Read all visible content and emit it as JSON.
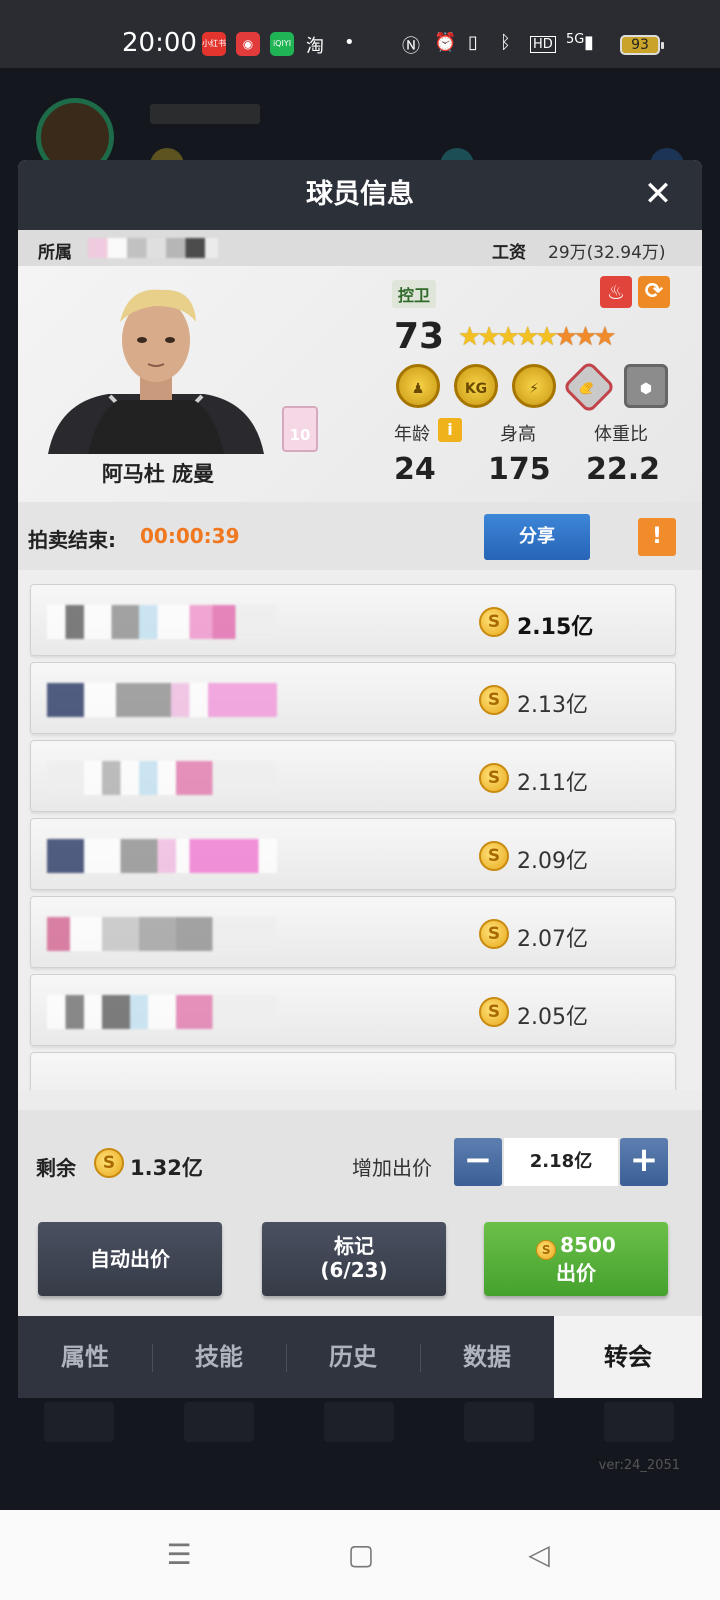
{
  "status_bar": {
    "time": "20:00",
    "apps": [
      "小红书",
      "网易云",
      "iQIYI",
      "淘"
    ],
    "dot": "•",
    "network": "5G",
    "hd": "HD",
    "battery": "93"
  },
  "modal": {
    "title": "球员信息",
    "close_glyph": "✕"
  },
  "info_row": {
    "owner_label": "所属",
    "salary_label": "工资",
    "salary_value": "29万(32.94万)"
  },
  "player": {
    "name": "阿马杜 庞曼",
    "jersey_number": "10",
    "position": "控卫",
    "rating": "73",
    "stars": {
      "gold": 5,
      "orange": 3
    },
    "badges": [
      "KG"
    ],
    "stats": {
      "age_label": "年龄",
      "age": "24",
      "height_label": "身高",
      "height": "175",
      "weight_ratio_label": "体重比",
      "weight_ratio": "22.2"
    }
  },
  "auction": {
    "end_label": "拍卖结束:",
    "countdown": "00:00:39",
    "share_label": "分享",
    "warning_glyph": "!"
  },
  "bids": [
    {
      "amount": "2.15亿"
    },
    {
      "amount": "2.13亿"
    },
    {
      "amount": "2.11亿"
    },
    {
      "amount": "2.09亿"
    },
    {
      "amount": "2.07亿"
    },
    {
      "amount": "2.05亿"
    }
  ],
  "controls": {
    "remaining_label": "剩余",
    "remaining_value": "1.32亿",
    "raise_label": "增加出价",
    "raise_value": "2.18亿",
    "minus_glyph": "−",
    "plus_glyph": "+",
    "auto_bid_label": "自动出价",
    "mark_label": "标记",
    "mark_count": "(6/23)",
    "bid_cost": "8500",
    "bid_label": "出价",
    "coin_glyph": "S"
  },
  "tabs": [
    "属性",
    "技能",
    "历史",
    "数据",
    "转会"
  ],
  "active_tab": "转会",
  "version": "ver:24_2051",
  "nav": {
    "menu": "☰",
    "home": "▢",
    "back": "◁"
  }
}
